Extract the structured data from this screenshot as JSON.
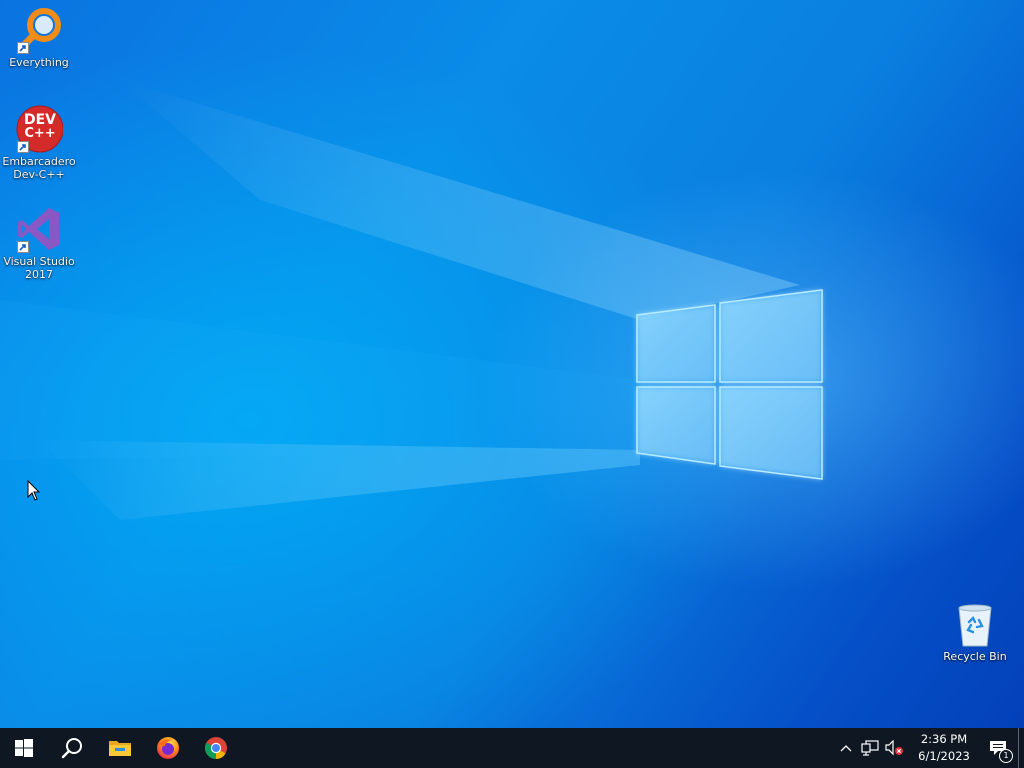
{
  "desktop": {
    "icons": [
      {
        "label": "Everything",
        "icon": "everything-search-icon"
      },
      {
        "label": "Embarcadero Dev-C++",
        "icon": "devcpp-icon",
        "logo_text_top": "DEV",
        "logo_text_bottom": "C++"
      },
      {
        "label": "Visual Studio 2017",
        "icon": "visual-studio-icon"
      },
      {
        "label": "Recycle Bin",
        "icon": "recycle-bin-icon"
      }
    ]
  },
  "taskbar": {
    "pinned": [
      {
        "name": "start",
        "icon": "windows-start-icon"
      },
      {
        "name": "search",
        "icon": "search-icon"
      },
      {
        "name": "file-explorer",
        "icon": "folder-icon"
      },
      {
        "name": "firefox",
        "icon": "firefox-icon"
      },
      {
        "name": "chrome",
        "icon": "chrome-icon"
      }
    ],
    "tray": {
      "time": "2:36 PM",
      "date": "6/1/2023",
      "notification_count": "1"
    }
  },
  "colors": {
    "taskbar": "#0f1822",
    "desktop_primary": "#0a7fe0",
    "devcpp_red": "#d42a2a",
    "vs_purple": "#8a58c4",
    "everything_orange": "#f28c18"
  }
}
